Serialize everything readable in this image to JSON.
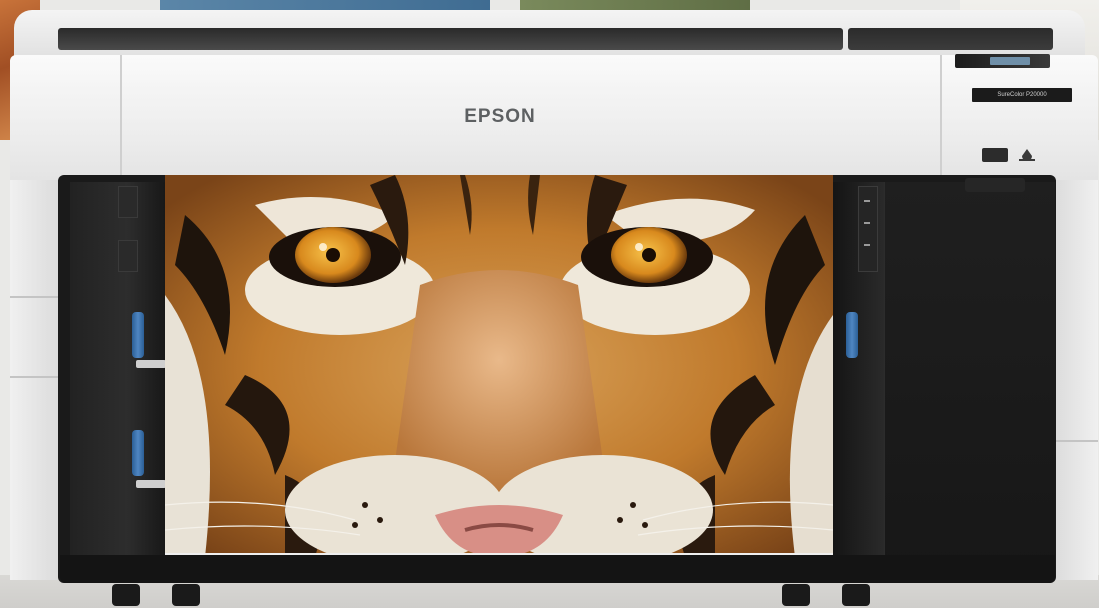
{
  "product": {
    "brand": "EPSON",
    "model_badge": "SureColor P20000",
    "icons": [
      "media-badge-icon",
      "ink-drop-icon"
    ]
  },
  "print": {
    "subject": "tiger-face-print"
  },
  "colors": {
    "printer_body": "#eeeeee",
    "cabinet": "#1a1a1a",
    "roll_knob": "#3b72ad",
    "tiger_orange": "#c9822f"
  }
}
